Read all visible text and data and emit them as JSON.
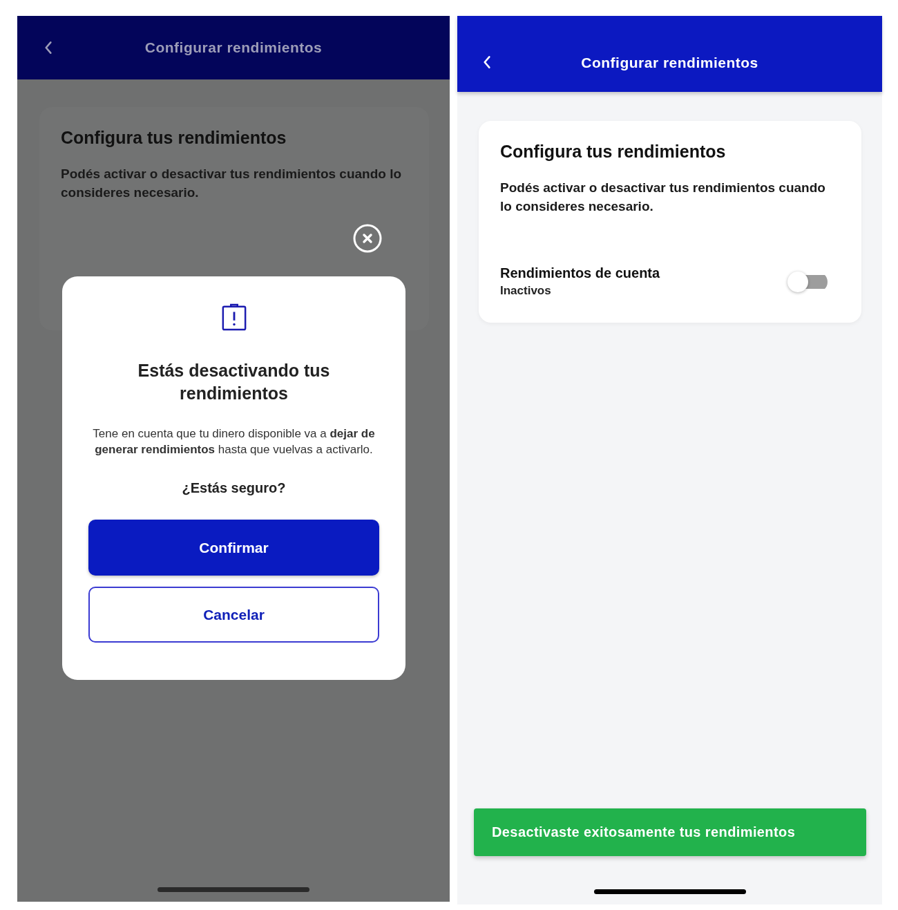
{
  "screens": [
    {
      "dimmed": true,
      "header": {
        "title": "Configurar rendimientos"
      },
      "card": {
        "title": "Configura tus rendimientos",
        "text": "Podés activar o desactivar tus rendimientos cuando lo consideres necesario."
      },
      "dialog": {
        "title": "Estás desactivando tus rendimientos",
        "text": "Tene en cuenta que tu dinero disponible va a **dejar de generar rendimientos** hasta que vuelvas a activarlo.",
        "question": "¿Estás seguro?",
        "buttons": [
          {
            "label": "Confirmar",
            "kind": "primary"
          },
          {
            "label": "Cancelar",
            "kind": "secondary"
          }
        ]
      }
    },
    {
      "dimmed": false,
      "header": {
        "title": "Configurar rendimientos"
      },
      "card": {
        "title": "Configura tus rendimientos",
        "text": "Podés activar o desactivar tus rendimientos cuando lo consideres necesario.",
        "setting": {
          "label": "Rendimientos de cuenta",
          "status": "Inactivos",
          "on": false
        }
      },
      "toast": {
        "text": "Desactivaste exitosamente tus rendimientos"
      }
    }
  ]
}
